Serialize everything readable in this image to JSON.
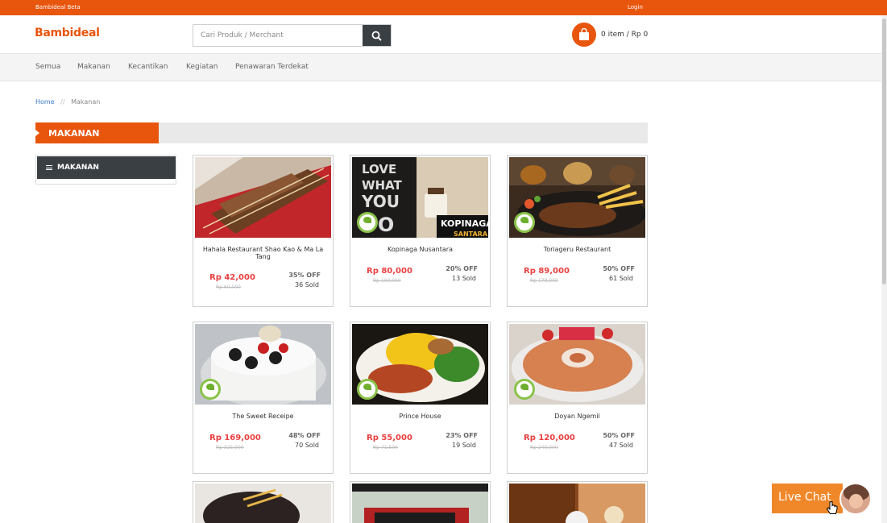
{
  "topbar": {
    "brand": "Bambideal Beta",
    "login": "Login"
  },
  "header": {
    "logo": "Bambideal",
    "search_placeholder": "Cari Produk / Merchant",
    "cart": "0 item / Rp 0"
  },
  "nav": [
    "Semua",
    "Makanan",
    "Kecantikan",
    "Kegiatan",
    "Penawaran Terdekat"
  ],
  "breadcrumb": {
    "home": "Home",
    "separator": "//",
    "current": "Makanan"
  },
  "section_title": "MAKANAN",
  "sidebar_heading": "MAKANAN",
  "products": [
    {
      "name": "Hahala Restaurant Shao Kao & Ma La Tang",
      "price": "Rp 42,000",
      "old_price": "Rp 60,000",
      "off": "35% OFF",
      "sold": "36 Sold",
      "badge": false
    },
    {
      "name": "Kopinaga Nusantara",
      "price": "Rp 80,000",
      "old_price": "Rp 100,000",
      "off": "20% OFF",
      "sold": "13 Sold",
      "badge": true
    },
    {
      "name": "Toriageru Restaurant",
      "price": "Rp 89,000",
      "old_price": "Rp 178,000",
      "off": "50% OFF",
      "sold": "61 Sold",
      "badge": true
    },
    {
      "name": "The Sweet Receipe",
      "price": "Rp 169,000",
      "old_price": "Rp 325,000",
      "off": "48% OFF",
      "sold": "70 Sold",
      "badge": true
    },
    {
      "name": "Prince House",
      "price": "Rp 55,000",
      "old_price": "Rp 71,500",
      "off": "23% OFF",
      "sold": "19 Sold",
      "badge": true
    },
    {
      "name": "Doyan Ngemil",
      "price": "Rp 120,000",
      "old_price": "Rp 240,000",
      "off": "50% OFF",
      "sold": "47 Sold",
      "badge": true
    }
  ],
  "livechat": "Live Chat",
  "colors": {
    "brand": "#e8550d",
    "dark": "#3a3f44",
    "price": "#e84040"
  }
}
